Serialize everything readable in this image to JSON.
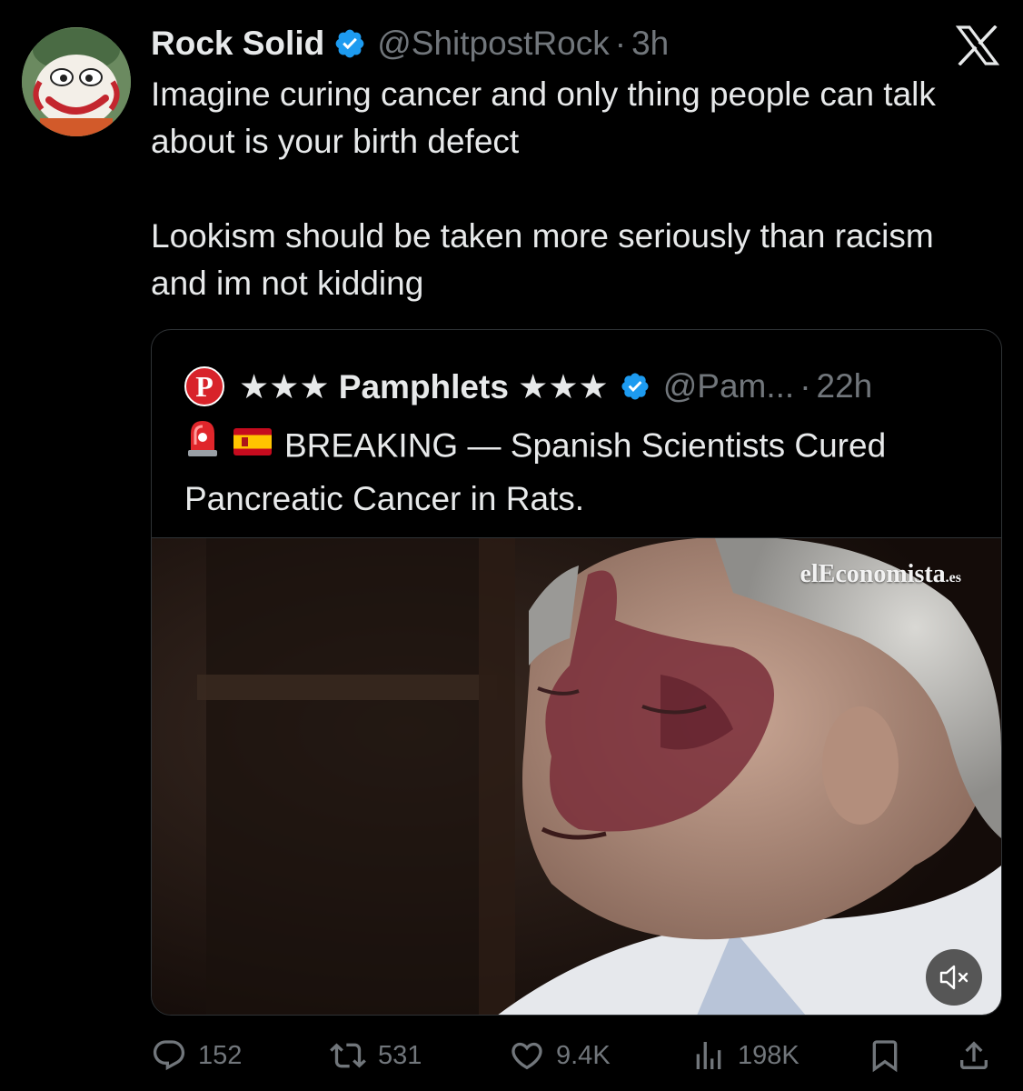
{
  "tweet": {
    "display_name": "Rock Solid",
    "handle": "@ShitpostRock",
    "separator": "·",
    "time": "3h",
    "paragraphs": [
      "Imagine curing cancer and only thing people can talk about is your birth defect",
      "Lookism should be taken more seriously than racism and im not kidding"
    ]
  },
  "quote": {
    "avatar_letter": "P",
    "display_name": "★★★ Pamphlets ★★★",
    "handle": "@Pam...",
    "separator": "·",
    "time": "22h",
    "text": "BREAKING — Spanish Scientists Cured Pancreatic Cancer in Rats.",
    "emojis": [
      "rotating-light",
      "flag-spain"
    ],
    "media": {
      "watermark": "elEconomista",
      "watermark_suffix": ".es"
    }
  },
  "actions": {
    "replies": "152",
    "reposts": "531",
    "likes": "9.4K",
    "views": "198K"
  },
  "colors": {
    "background": "#000000",
    "text": "#e7e9ea",
    "secondary": "#71767b",
    "verified": "#1d9bf0",
    "border": "#2f3336"
  }
}
